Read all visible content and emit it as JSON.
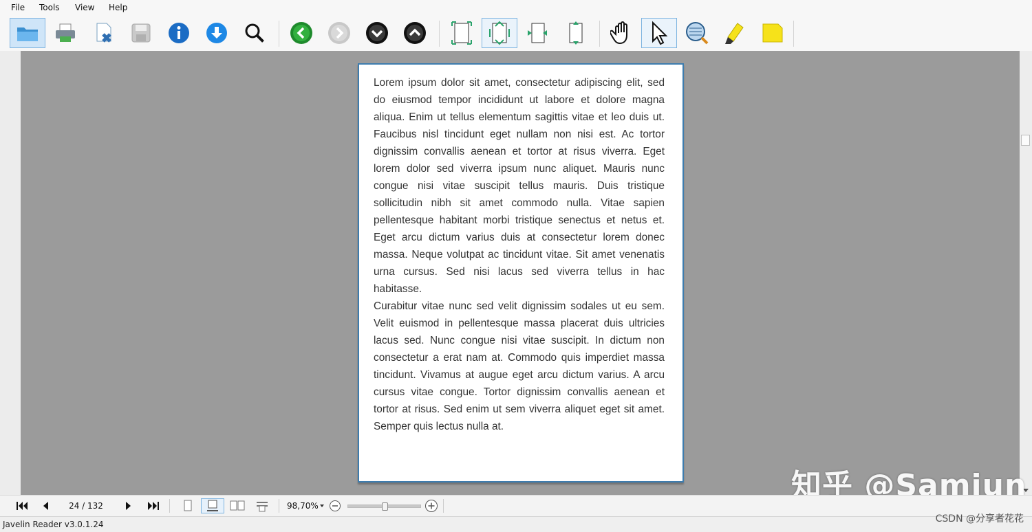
{
  "menu": {
    "items": [
      "File",
      "Tools",
      "View",
      "Help"
    ]
  },
  "toolbar": {
    "buttons": [
      "open-folder",
      "print",
      "close-document",
      "save",
      "info",
      "download",
      "search",
      "previous",
      "next",
      "up",
      "down",
      "fit-page",
      "fit-width",
      "rotate-left",
      "rotate-right",
      "hand-tool",
      "select-tool",
      "magnifier-tool",
      "highlight",
      "note"
    ],
    "accent": "#3d7cae"
  },
  "document": {
    "paragraphs": [
      "Lorem ipsum dolor sit amet, consectetur adipiscing elit, sed do eiusmod tempor incididunt ut labore et dolore magna aliqua. Enim ut tellus elementum sagittis vitae et leo duis ut. Faucibus nisl tincidunt eget nullam non nisi est. Ac tortor dignissim convallis aenean et tortor at risus viverra. Eget lorem dolor sed viverra ipsum nunc aliquet. Mauris nunc congue nisi vitae suscipit tellus mauris. Duis tristique sollicitudin nibh sit amet commodo nulla. Vitae sapien pellentesque habitant morbi tristique senectus et netus et. Eget arcu dictum varius duis at consectetur lorem donec massa. Neque volutpat ac tincidunt vitae. Sit amet venenatis urna cursus. Sed nisi lacus sed viverra tellus in hac habitasse.",
      "Curabitur vitae nunc sed velit dignissim sodales ut eu sem. Velit euismod in pellentesque massa placerat duis ultricies lacus sed. Nunc congue nisi vitae suscipit. In dictum non consectetur a erat nam at. Commodo quis imperdiet massa tincidunt. Vivamus at augue eget arcu dictum varius. A arcu cursus vitae congue. Tortor dignissim convallis aenean et tortor at risus. Sed enim ut sem viverra aliquet eget sit amet. Semper quis lectus nulla at."
    ]
  },
  "navigation": {
    "page_indicator": "24 / 132",
    "zoom_level": "98,70%",
    "zoom_slider_fraction": 0.5
  },
  "status": {
    "app_version": "Javelin Reader v3.0.1.24"
  },
  "watermark": {
    "text": "知乎 @Samjun"
  },
  "source_label": "CSDN @分享者花花"
}
